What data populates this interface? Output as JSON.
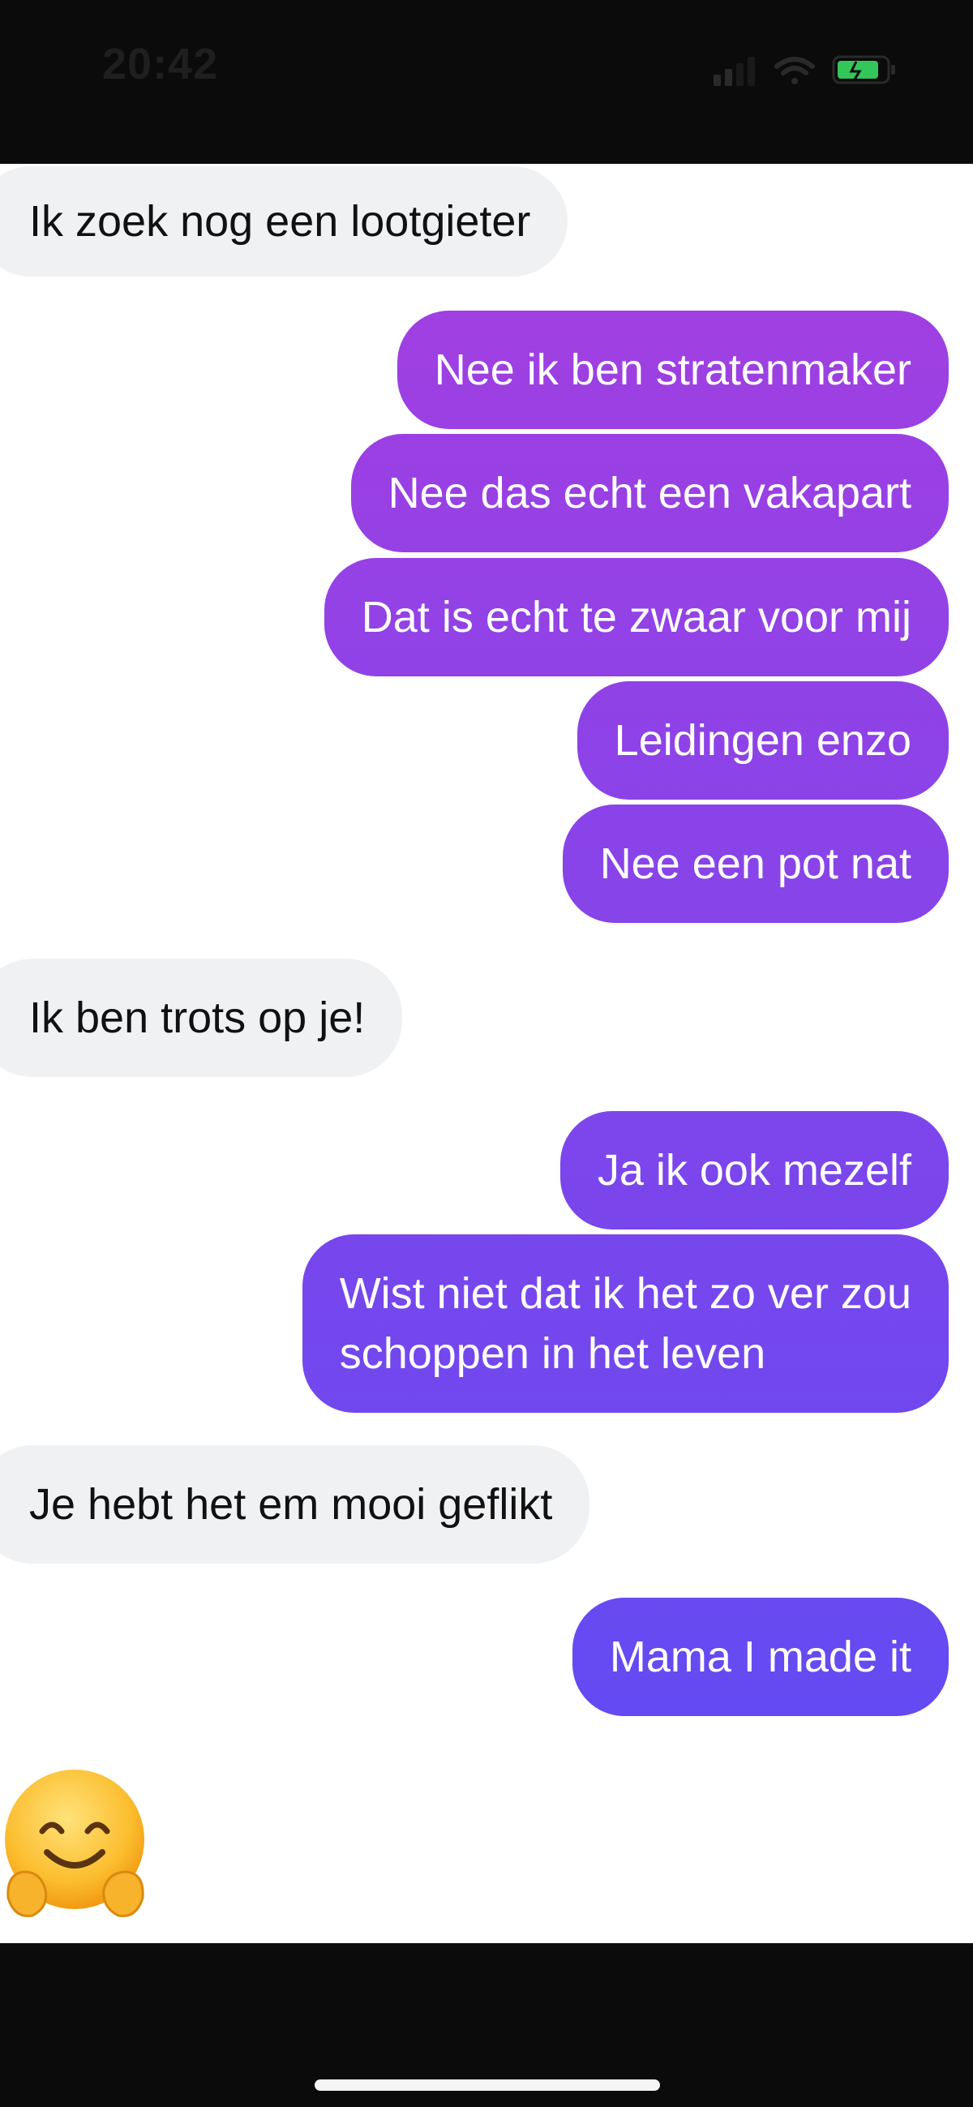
{
  "status_bar": {
    "time": "20:42"
  },
  "colors": {
    "incoming_bubble": "#f0f1f3",
    "outgoing_gradient_top": "#a63ee0",
    "outgoing_gradient_bottom": "#5a4cf5",
    "battery": "#33c759"
  },
  "messages": [
    {
      "side": "incoming",
      "text": "Ik zoek nog een lootgieter"
    },
    {
      "side": "outgoing",
      "text": "Nee ik ben stratenmaker"
    },
    {
      "side": "outgoing",
      "text": "Nee das echt een vakapart"
    },
    {
      "side": "outgoing",
      "text": "Dat is echt te zwaar voor mij"
    },
    {
      "side": "outgoing",
      "text": "Leidingen enzo"
    },
    {
      "side": "outgoing",
      "text": "Nee een pot nat"
    },
    {
      "side": "incoming",
      "text": "Ik ben trots op je!"
    },
    {
      "side": "outgoing",
      "text": "Ja ik ook mezelf"
    },
    {
      "side": "outgoing",
      "lines": [
        "Wist niet dat ik het zo ver zou",
        "schoppen in het leven"
      ]
    },
    {
      "side": "incoming",
      "text": "Je hebt het em mooi geflikt"
    },
    {
      "side": "outgoing",
      "text": "Mama I made it"
    }
  ],
  "reaction": {
    "icon": "hugging-face-emoji"
  }
}
